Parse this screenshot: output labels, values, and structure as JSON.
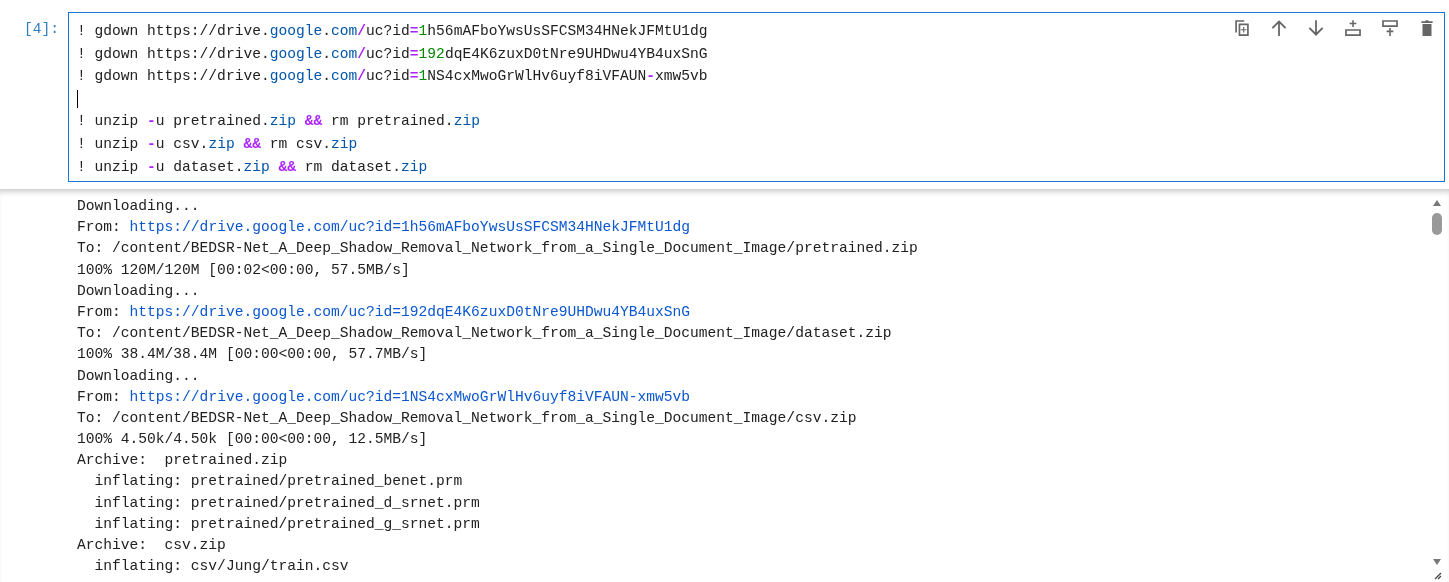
{
  "cell": {
    "prompt": "[4]:",
    "code_lines": [
      {
        "cursor": false,
        "tokens": [
          {
            "kind": "plain",
            "text": "! gdown https://drive."
          },
          {
            "kind": "name",
            "text": "google"
          },
          {
            "kind": "plain",
            "text": "."
          },
          {
            "kind": "name",
            "text": "com"
          },
          {
            "kind": "op",
            "text": "/"
          },
          {
            "kind": "plain",
            "text": "uc?id"
          },
          {
            "kind": "op",
            "text": "="
          },
          {
            "kind": "number",
            "text": "1"
          },
          {
            "kind": "plain",
            "text": "h56mAFboYwsUsSFCSM34HNekJFMtU1dg"
          }
        ]
      },
      {
        "cursor": false,
        "tokens": [
          {
            "kind": "plain",
            "text": "! gdown https://drive."
          },
          {
            "kind": "name",
            "text": "google"
          },
          {
            "kind": "plain",
            "text": "."
          },
          {
            "kind": "name",
            "text": "com"
          },
          {
            "kind": "op",
            "text": "/"
          },
          {
            "kind": "plain",
            "text": "uc?id"
          },
          {
            "kind": "op",
            "text": "="
          },
          {
            "kind": "number",
            "text": "192"
          },
          {
            "kind": "plain",
            "text": "dqE4K6zuxD0tNre9UHDwu4YB4uxSnG"
          }
        ]
      },
      {
        "cursor": false,
        "tokens": [
          {
            "kind": "plain",
            "text": "! gdown https://drive."
          },
          {
            "kind": "name",
            "text": "google"
          },
          {
            "kind": "plain",
            "text": "."
          },
          {
            "kind": "name",
            "text": "com"
          },
          {
            "kind": "op",
            "text": "/"
          },
          {
            "kind": "plain",
            "text": "uc?id"
          },
          {
            "kind": "op",
            "text": "="
          },
          {
            "kind": "number",
            "text": "1"
          },
          {
            "kind": "plain",
            "text": "NS4cxMwoGrWlHv6uyf8iVFAUN"
          },
          {
            "kind": "op",
            "text": "-"
          },
          {
            "kind": "plain",
            "text": "xmw5vb"
          }
        ]
      },
      {
        "cursor": true
      },
      {
        "cursor": false,
        "tokens": [
          {
            "kind": "plain",
            "text": "! unzip "
          },
          {
            "kind": "op",
            "text": "-"
          },
          {
            "kind": "plain",
            "text": "u pretrained."
          },
          {
            "kind": "name",
            "text": "zip"
          },
          {
            "kind": "op",
            "text": " &&"
          },
          {
            "kind": "plain",
            "text": " rm pretrained."
          },
          {
            "kind": "name",
            "text": "zip"
          }
        ]
      },
      {
        "cursor": false,
        "tokens": [
          {
            "kind": "plain",
            "text": "! unzip "
          },
          {
            "kind": "op",
            "text": "-"
          },
          {
            "kind": "plain",
            "text": "u csv."
          },
          {
            "kind": "name",
            "text": "zip"
          },
          {
            "kind": "op",
            "text": " &&"
          },
          {
            "kind": "plain",
            "text": " rm csv."
          },
          {
            "kind": "name",
            "text": "zip"
          }
        ]
      },
      {
        "cursor": false,
        "tokens": [
          {
            "kind": "plain",
            "text": "! unzip "
          },
          {
            "kind": "op",
            "text": "-"
          },
          {
            "kind": "plain",
            "text": "u dataset."
          },
          {
            "kind": "name",
            "text": "zip"
          },
          {
            "kind": "op",
            "text": " &&"
          },
          {
            "kind": "plain",
            "text": " rm dataset."
          },
          {
            "kind": "name",
            "text": "zip"
          }
        ]
      }
    ]
  },
  "output_lines": [
    {
      "text": "Downloading..."
    },
    {
      "text": "From:",
      "link": "https://drive.google.com/uc?id=1h56mAFboYwsUsSFCSM34HNekJFMtU1dg"
    },
    {
      "text": "To: /content/BEDSR-Net_A_Deep_Shadow_Removal_Network_from_a_Single_Document_Image/pretrained.zip"
    },
    {
      "text": "100% 120M/120M [00:02<00:00, 57.5MB/s]"
    },
    {
      "text": "Downloading..."
    },
    {
      "text": "From:",
      "link": "https://drive.google.com/uc?id=192dqE4K6zuxD0tNre9UHDwu4YB4uxSnG"
    },
    {
      "text": "To: /content/BEDSR-Net_A_Deep_Shadow_Removal_Network_from_a_Single_Document_Image/dataset.zip"
    },
    {
      "text": "100% 38.4M/38.4M [00:00<00:00, 57.7MB/s]"
    },
    {
      "text": "Downloading..."
    },
    {
      "text": "From:",
      "link": "https://drive.google.com/uc?id=1NS4cxMwoGrWlHv6uyf8iVFAUN-xmw5vb"
    },
    {
      "text": "To: /content/BEDSR-Net_A_Deep_Shadow_Removal_Network_from_a_Single_Document_Image/csv.zip"
    },
    {
      "text": "100% 4.50k/4.50k [00:00<00:00, 12.5MB/s]"
    },
    {
      "text": "Archive:  pretrained.zip"
    },
    {
      "text": "  inflating: pretrained/pretrained_benet.prm"
    },
    {
      "text": "  inflating: pretrained/pretrained_d_srnet.prm"
    },
    {
      "text": "  inflating: pretrained/pretrained_g_srnet.prm"
    },
    {
      "text": "Archive:  csv.zip"
    },
    {
      "text": "  inflating: csv/Jung/train.csv"
    }
  ]
}
